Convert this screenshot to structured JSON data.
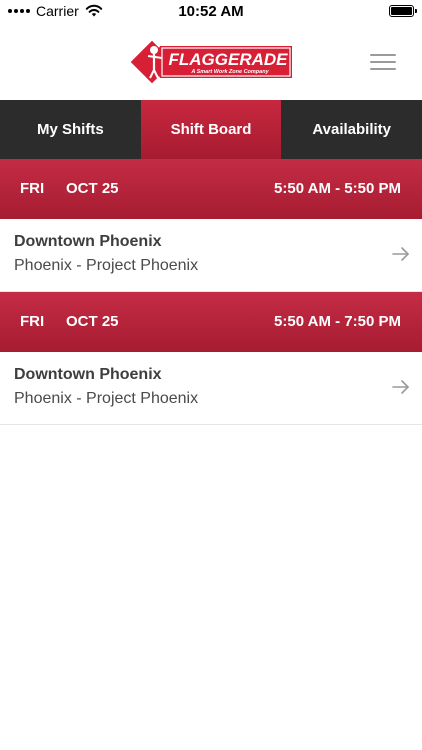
{
  "status_bar": {
    "carrier": "Carrier",
    "time": "10:52 AM",
    "icons": [
      "signal-dots-icon",
      "wifi-icon",
      "battery-icon"
    ]
  },
  "header": {
    "logo_text": "FLAGGERADE",
    "logo_tagline": "A Smart Work Zone Company",
    "menu_icon": "hamburger-menu-icon",
    "brand_color": "#d71f36"
  },
  "tabs": [
    {
      "label": "My Shifts",
      "active": false
    },
    {
      "label": "Shift Board",
      "active": true
    },
    {
      "label": "Availability",
      "active": false
    }
  ],
  "shifts": [
    {
      "day": "FRI",
      "date": "OCT 25",
      "time": "5:50 AM - 5:50 PM",
      "title": "Downtown Phoenix",
      "subtitle": "Phoenix - Project Phoenix",
      "icon": "arrow-right-icon"
    },
    {
      "day": "FRI",
      "date": "OCT 25",
      "time": "5:50 AM - 7:50 PM",
      "title": "Downtown Phoenix",
      "subtitle": "Phoenix - Project Phoenix",
      "icon": "arrow-right-icon"
    }
  ],
  "colors": {
    "tab_bar": "#2c2c2c",
    "accent_red": "#b8233a",
    "text_dark": "#3e3e3e"
  }
}
